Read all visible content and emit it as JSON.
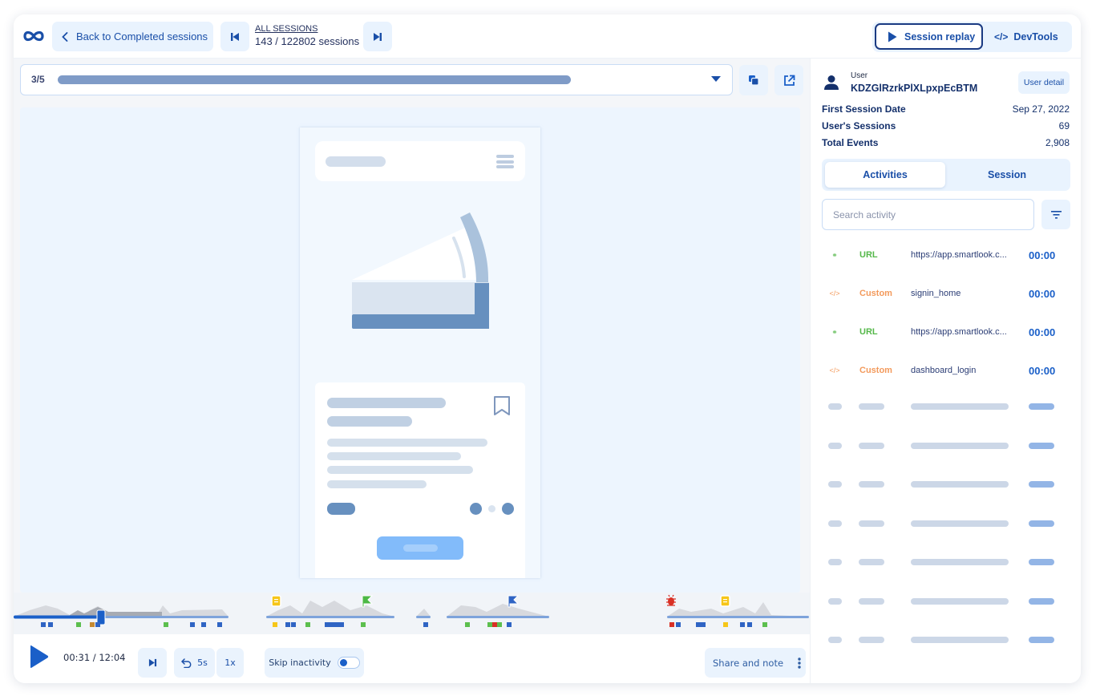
{
  "topbar": {
    "logo_icon": "infinity-logo-icon",
    "back_label": "Back to Completed sessions",
    "all_sessions_label": "ALL SESSIONS",
    "sessions_count": "143 / 122802 sessions",
    "modes": {
      "replay": "Session replay",
      "devtools": "DevTools"
    },
    "active_mode": "Session replay"
  },
  "url_bar": {
    "page_indicator": "3/5"
  },
  "player": {
    "current_time": "00:31",
    "total_time": "12:04",
    "time_readout": "00:31 / 12:04",
    "progress_fraction": 0.043,
    "rewind_label": "5s",
    "speed_label": "1x",
    "skip_inactivity_label": "Skip inactivity",
    "skip_inactivity_on": false,
    "share_label": "Share and note"
  },
  "timeline": {
    "event_colors": {
      "navigation": "#2f64c4",
      "click": "#5cbf4e",
      "note": "#f6c619",
      "error": "#d93025",
      "rage": "#c58a33"
    },
    "markers": [
      {
        "type": "note",
        "icon": "note-icon",
        "color": "#f6c619"
      },
      {
        "type": "goal",
        "icon": "green-flag-icon",
        "color": "#4cb845"
      },
      {
        "type": "goal",
        "icon": "blue-flag-icon",
        "color": "#2f64c4"
      },
      {
        "type": "error",
        "icon": "bug-icon",
        "color": "#d93025"
      },
      {
        "type": "note",
        "icon": "note-icon",
        "color": "#f6c619"
      }
    ]
  },
  "user_panel": {
    "user_label": "User",
    "user_id": "KDZGlRzrkPlXLpxpEcBTM",
    "user_detail_label": "User detail",
    "stats": [
      {
        "label": "First Session Date",
        "value": "Sep 27, 2022"
      },
      {
        "label": "User's Sessions",
        "value": "69"
      },
      {
        "label": "Total Events",
        "value": "2,908"
      }
    ],
    "tabs": [
      {
        "label": "Activities",
        "active": true
      },
      {
        "label": "Session",
        "active": false
      }
    ],
    "search_placeholder": "Search activity",
    "activities": [
      {
        "icon": "link-icon",
        "type": "URL",
        "value": "https://app.smartlook.c...",
        "time": "00:00",
        "color": "#55b84a"
      },
      {
        "icon": "code-icon",
        "type": "Custom",
        "value": "signin_home",
        "time": "00:00",
        "color": "#f39a5c"
      },
      {
        "icon": "link-icon",
        "type": "URL",
        "value": "https://app.smartlook.c...",
        "time": "00:00",
        "color": "#55b84a"
      },
      {
        "icon": "code-icon",
        "type": "Custom",
        "value": "dashboard_login",
        "time": "00:00",
        "color": "#f39a5c"
      }
    ],
    "loading_rows": 7
  },
  "colors": {
    "accent": "#1a4fa8",
    "accent_bright": "#1a5fc8",
    "soft_bg": "#e9f3fe"
  }
}
